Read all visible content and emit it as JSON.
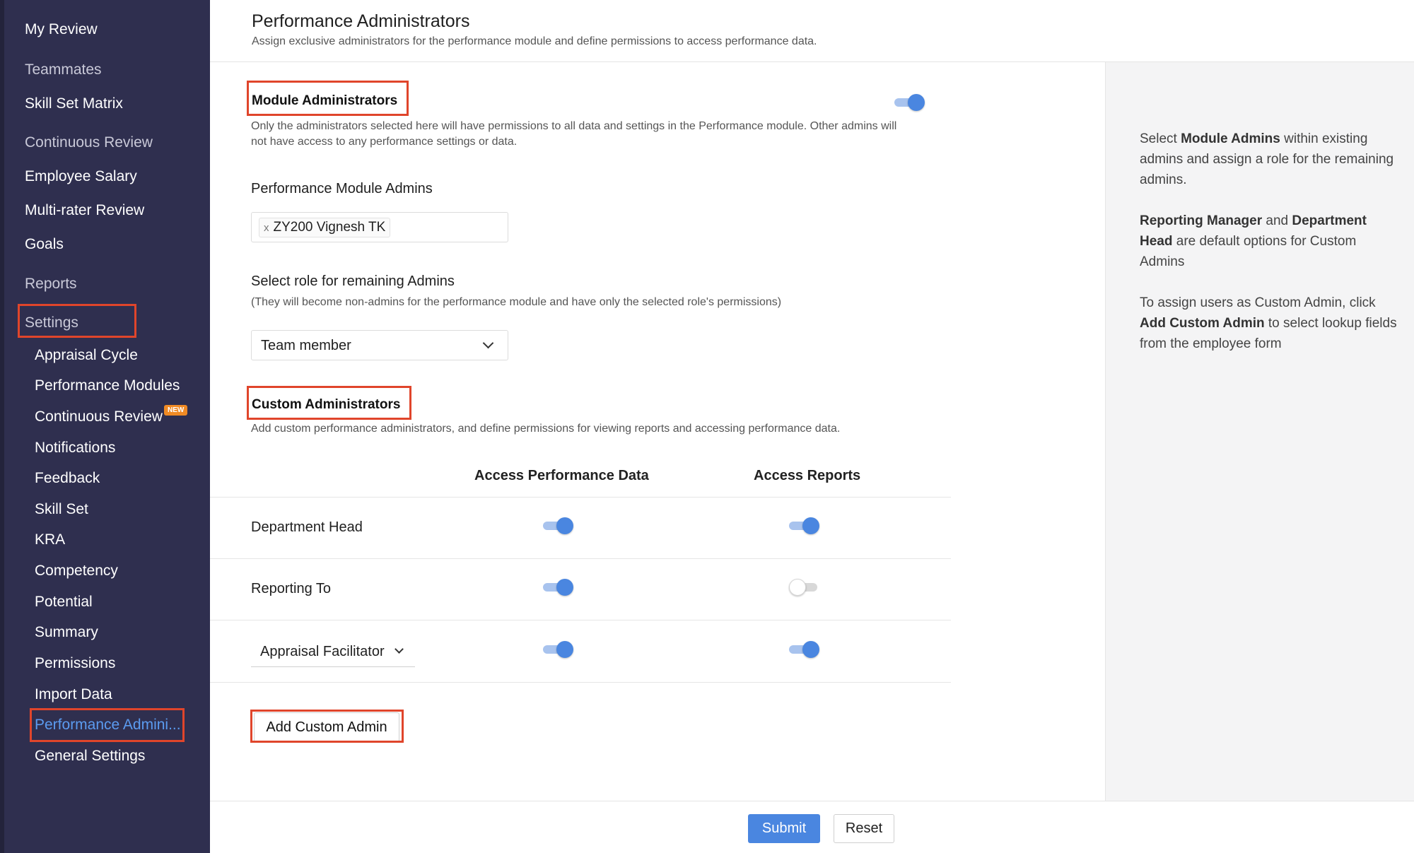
{
  "sidebar": {
    "items": [
      {
        "label": "My Review"
      },
      {
        "label": "Teammates"
      },
      {
        "label": "Skill Set Matrix"
      },
      {
        "label": "Continuous Review"
      },
      {
        "label": "Employee Salary"
      },
      {
        "label": "Multi-rater Review"
      },
      {
        "label": "Goals"
      },
      {
        "label": "Reports"
      },
      {
        "label": "Settings"
      }
    ],
    "settings_items": [
      {
        "label": "Appraisal Cycle"
      },
      {
        "label": "Performance Modules"
      },
      {
        "label": "Continuous Review"
      },
      {
        "label": "Notifications"
      },
      {
        "label": "Feedback"
      },
      {
        "label": "Skill Set"
      },
      {
        "label": "KRA"
      },
      {
        "label": "Competency"
      },
      {
        "label": "Potential"
      },
      {
        "label": "Summary"
      },
      {
        "label": "Permissions"
      },
      {
        "label": "Import Data"
      },
      {
        "label": "Performance Admini..."
      },
      {
        "label": "General Settings"
      }
    ],
    "new_badge": "NEW",
    "active_color": "#5b9bf0",
    "background_color": "#2f2f4f"
  },
  "header": {
    "title": "Performance Administrators",
    "subtitle": "Assign exclusive administrators for the performance module and define permissions to access performance data."
  },
  "module_admins": {
    "heading": "Module Administrators",
    "enabled": true,
    "description_line1": "Only the administrators selected here will have permissions to all data and settings in the Performance module. Other admins will",
    "description_line2": "not have access to any performance settings or data.",
    "field_label": "Performance Module Admins",
    "selected_tag": "ZY200 Vignesh TK",
    "remove_glyph": "x"
  },
  "remaining_role": {
    "label": "Select role for remaining Admins",
    "note": "(They will become non-admins for the performance module and have only the selected role's permissions)",
    "selected": "Team member"
  },
  "custom_admins": {
    "heading": "Custom Administrators",
    "description": "Add custom performance administrators, and define permissions for viewing reports and accessing performance data.",
    "columns": {
      "data": "Access Performance Data",
      "reports": "Access Reports"
    },
    "rows": [
      {
        "label": "Department Head",
        "access_data": true,
        "access_reports": true
      },
      {
        "label": "Reporting To",
        "access_data": true,
        "access_reports": false
      },
      {
        "label": "Appraisal Facilitator",
        "access_data": true,
        "access_reports": true
      }
    ],
    "add_button": "Add Custom Admin"
  },
  "help": {
    "p1_pre": "Select ",
    "p1_b1": "Module Admins",
    "p1_post": " within existing admins and assign a role for the remaining admins.",
    "p2_b1": "Reporting Manager",
    "p2_mid": " and ",
    "p2_b2": "Department Head",
    "p2_post": " are default options for Custom Admins",
    "p3_pre": "To assign users as Custom Admin, click ",
    "p3_b1": "Add Custom Admin",
    "p3_post": " to select lookup fields from the employee form"
  },
  "footer": {
    "submit": "Submit",
    "reset": "Reset"
  },
  "colors": {
    "accent": "#4a86e0",
    "highlight": "#e0452b",
    "badge": "#f08a24"
  }
}
